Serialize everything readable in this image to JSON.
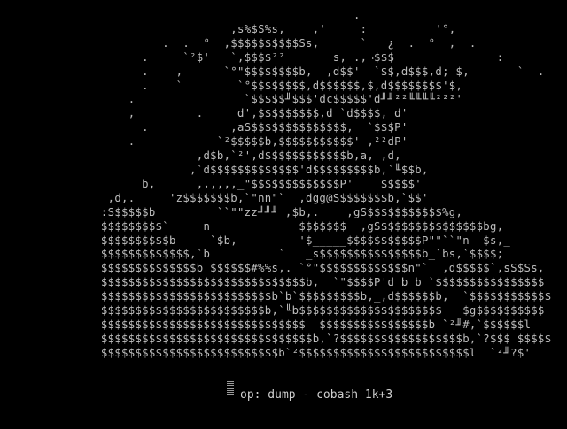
{
  "art": {
    "lines": [
      "                                            .",
      "                          ,s%$S%s,    ,'     :          '°,",
      "                .  .  °  ,$$$$$$$$$$Ss,      `   ¿  .  °  ,  .",
      "             .     `²$'   `,$$$$²²       s, .,¬$$$               :",
      "             .    ,      `°\"$$$$$$$$b,  ,d$$'  `$$,d$$$,d; $,       `  .",
      "             .    `        `°$$$$$$$$,d$$$$$$,$,d$$$$$$$$'$,",
      "           .                `$$$$$╜$$$'d¢$$$$$'d╜╜²²╙╙╙╙²²²'",
      "           ,         .     d',$$$$$$$$$,d `d$$$$, d'",
      "             .            ,aS$$$$$$$$$$$$$$,  `$$$P'",
      "           .            `²$$$$$b,$$$$$$$$$$$' ,²²dP'",
      "                     ,d$b,`²',d$$$$$$$$$$$$b,a, ,d,",
      "                    ,`d$$$$$$$$$$$$$'d$$$$$$$$$b,`╙$$b,",
      "             b,      ,,,,,,_\"$$$$$$$$$$$$$P'    $$$$$'",
      "        ,d,.     'z$$$$$$$b,`\"nn\"`  ,dgg@S$$$$$$$b,`$$'",
      "       :S$$$$$b_        ``\"\"zz╜╜╜ ,$b,.    ,gS$$$$$$$$$$$%g,",
      "       $$$$$$$$$`     n             $$$$$$$  ,gS$$$$$$$$$$$$$$$bg,",
      "       $$$$$$$$$$b     `$b,         '$_____$$$$$$$$$$$P\"\"``\"n  $s,_",
      "       $$$$$$$$$$$$$,`b          `   _s$$$$$$$$$$$$$$$b_`bs,`$$$$;",
      "       $$$$$$$$$$$$$$b $$$$$$#%%s,. `°\"$$$$$$$$$$$$$n\"`  ,d$$$$$`,sS$Ss,",
      "       $$$$$$$$$$$$$$$$$$$$$$$$$$$$$$b,  `\"$$$$P'd b b `$$$$$$$$$$$$$$$$",
      "       $$$$$$$$$$$$$$$$$$$$$$$$$b`b`$$$$$$$$$b,_,d$$$$$$b,  `$$$$$$$$$$$$",
      "       $$$$$$$$$$$$$$$$$$$$$$$$b,`╙b$$$$$$$$$$$$$$$$$$$$$   $g$$$$$$$$$$",
      "       $$$$$$$$$$$$$$$$$$$$$$$$$$$$$$  $$$$$$$$$$$$$$$$b `²╜#,`$$$$$$l",
      "       $$$$$$$$$$$$$$$$$$$$$$$$$$$$$$$b,`?$$$$$$$$$$$$$$$$$$b,`?$$$ $$$$$",
      "       $$$$$$$$$$$$$$$$$$$$$$$$$$b`²$$$$$$$$$$$$$$$$$$$$$$$$$l  `²╜?$'"
    ]
  },
  "status": {
    "text": "op: dump - cobash 1k+3"
  }
}
